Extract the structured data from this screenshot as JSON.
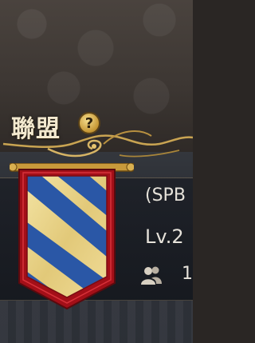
{
  "header": {
    "title": "聯盟",
    "help_glyph": "?"
  },
  "alliance": {
    "tag": "(SPB",
    "level": "Lv.2",
    "members": "1"
  },
  "icons": {
    "help": "question-mark-icon",
    "banner": "alliance-banner-icon",
    "members": "members-icon"
  },
  "colors": {
    "banner_border": "#b4121b",
    "stripe_blue": "#2a57a6",
    "stripe_gold": "#e9d58c",
    "title_text": "#f3e9cf"
  }
}
